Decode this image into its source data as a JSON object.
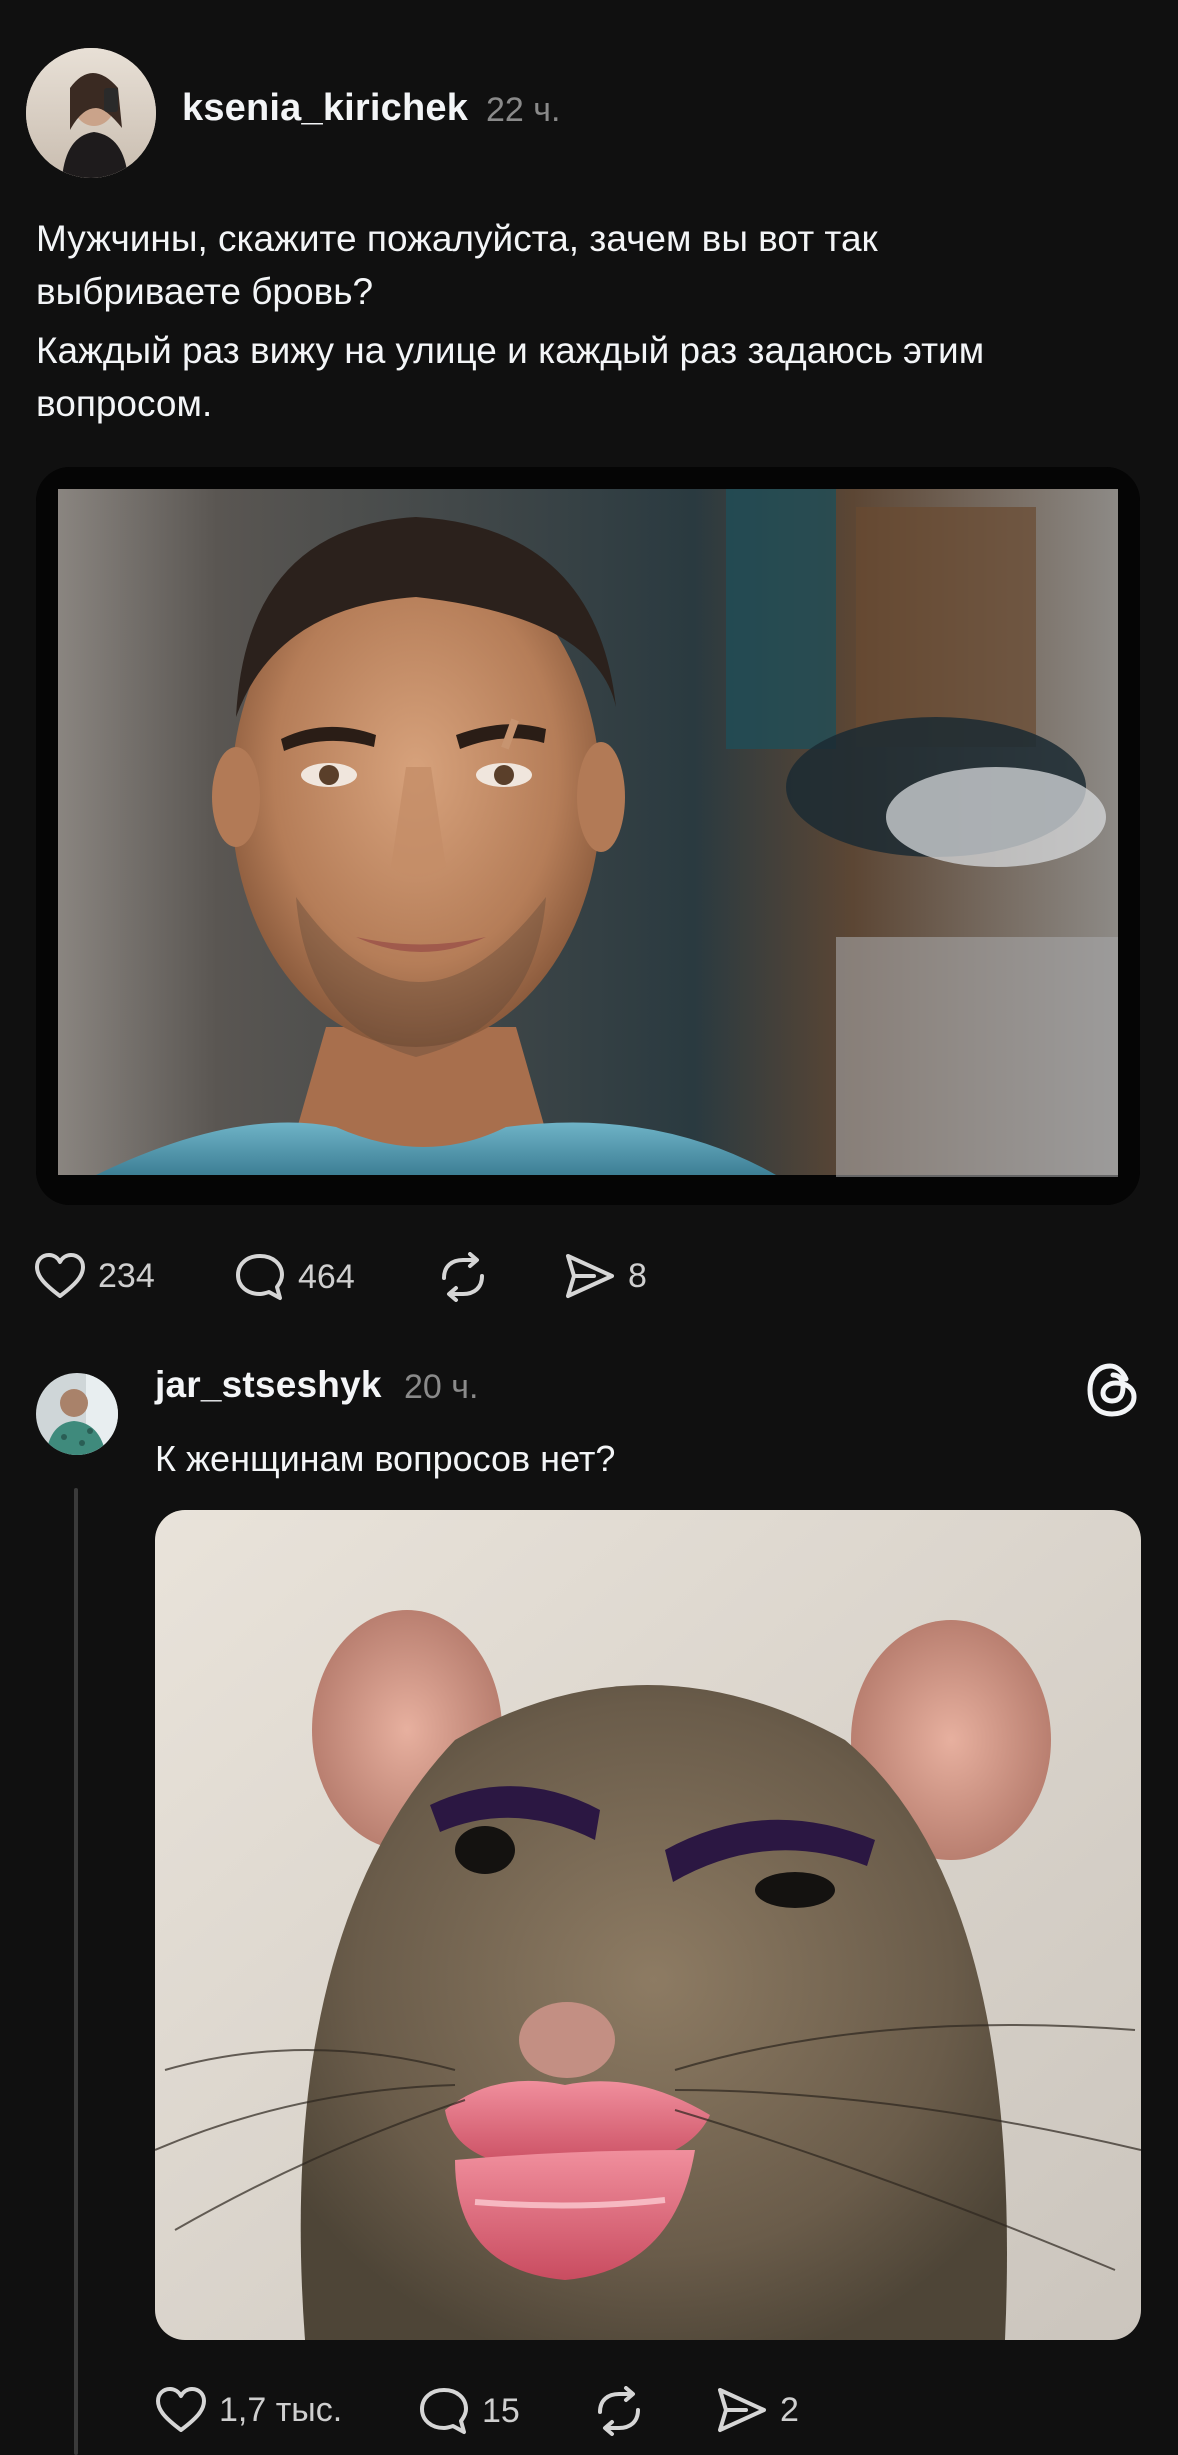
{
  "post": {
    "username": "ksenia_kirichek",
    "time": "22 ч.",
    "paragraphs": [
      "Мужчины, скажите пожалуйста, зачем вы вот так выбриваете бровь?",
      "Каждый раз вижу на улице и каждый раз задаюсь этим вопросом."
    ],
    "image_icon": "man-portrait-photo",
    "actions": {
      "likes": "234",
      "comments": "464",
      "shares": "8"
    }
  },
  "reply": {
    "username": "jar_stseshyk",
    "time": "20 ч.",
    "text": "К женщинам вопросов нет?",
    "image_icon": "rat-with-lips-photo",
    "actions": {
      "likes": "1,7 тыс.",
      "comments": "15",
      "shares": "2"
    }
  },
  "icons": {
    "heart": "heart-icon",
    "comment": "comment-icon",
    "repost": "repost-icon",
    "share": "share-icon",
    "threads": "threads-logo-icon"
  },
  "colors": {
    "background": "#101010",
    "text": "#f3f5f7",
    "muted": "#8a8a8a"
  }
}
